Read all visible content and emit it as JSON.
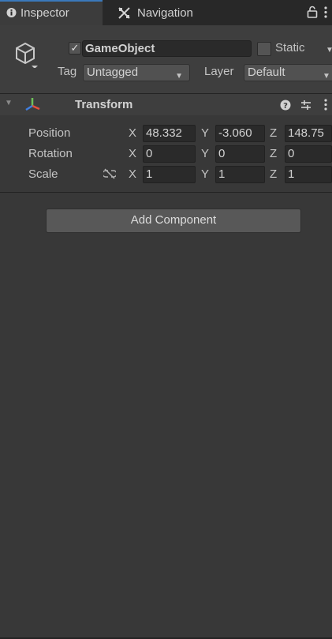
{
  "tabs": {
    "inspector": "Inspector",
    "navigation": "Navigation"
  },
  "gameobject": {
    "active": true,
    "name": "GameObject",
    "static_label": "Static",
    "static": false,
    "tag_label": "Tag",
    "tag_value": "Untagged",
    "layer_label": "Layer",
    "layer_value": "Default"
  },
  "transform": {
    "title": "Transform",
    "rows": [
      {
        "label": "Position",
        "x": "48.332",
        "y": "-3.060",
        "z": "148.75"
      },
      {
        "label": "Rotation",
        "x": "0",
        "y": "0",
        "z": "0"
      },
      {
        "label": "Scale",
        "x": "1",
        "y": "1",
        "z": "1"
      }
    ],
    "axes": {
      "x": "X",
      "y": "Y",
      "z": "Z"
    }
  },
  "add_component_label": "Add Component",
  "colors": {
    "background": "#383838",
    "tab_accent": "#3a79bb",
    "field_bg": "#2a2a2a",
    "button_bg": "#585858"
  },
  "icons": [
    "info-icon",
    "navigation-icon",
    "lock-icon",
    "kebab-menu-icon",
    "cube-icon",
    "checkmark-icon",
    "foldout-arrow-icon",
    "transform-axes-icon",
    "help-icon",
    "preset-icon",
    "link-broken-icon"
  ]
}
